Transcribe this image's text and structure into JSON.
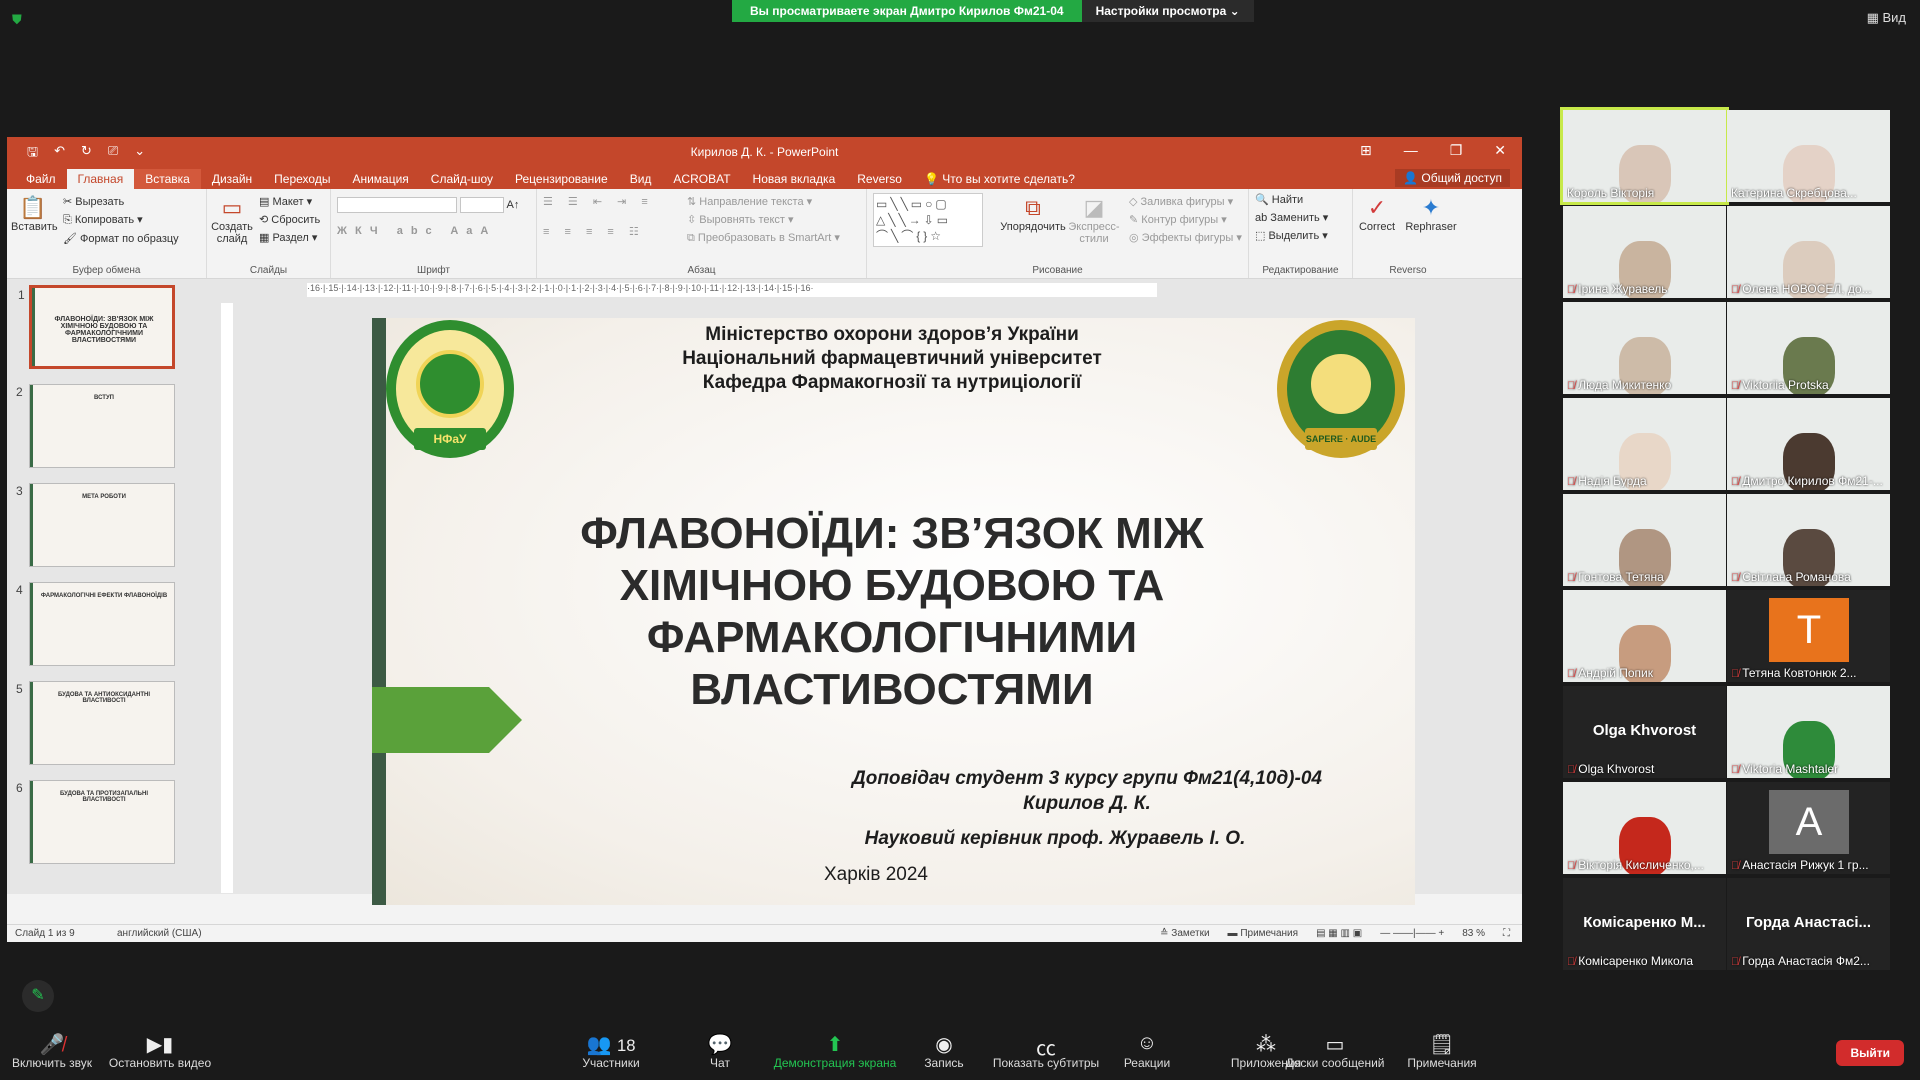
{
  "zoom": {
    "share_text": "Вы просматриваете экран Дмитро Кирилов Фм21-04",
    "view_settings": "Настройки просмотра",
    "view_label": "Вид",
    "toolbar": [
      {
        "label": "Включить звук",
        "icon": "mic-muted-icon"
      },
      {
        "label": "Остановить видео",
        "icon": "video-icon"
      },
      {
        "label": "Участники",
        "icon": "participants-icon",
        "count": "18"
      },
      {
        "label": "Чат",
        "icon": "chat-icon"
      },
      {
        "label": "Демонстрация экрана",
        "icon": "share-screen-icon"
      },
      {
        "label": "Запись",
        "icon": "record-icon"
      },
      {
        "label": "Показать субтитры",
        "icon": "cc-icon"
      },
      {
        "label": "Реакции",
        "icon": "reactions-icon"
      },
      {
        "label": "Приложения",
        "icon": "apps-icon"
      },
      {
        "label": "Доски сообщений",
        "icon": "whiteboard-icon"
      },
      {
        "label": "Примечания",
        "icon": "notes-icon"
      }
    ],
    "leave": "Выйти",
    "participants": [
      {
        "name": "Король Вікторія",
        "muted": false,
        "active": true
      },
      {
        "name": "Катерина Скребцова...",
        "muted": false
      },
      {
        "name": "Ірина Журавель",
        "muted": true
      },
      {
        "name": "Олена НОВОСЕЛ, до...",
        "muted": true
      },
      {
        "name": "Люда Микитенко",
        "muted": true
      },
      {
        "name": "Viktoriia Protska",
        "muted": true
      },
      {
        "name": "Надія Бурда",
        "muted": true
      },
      {
        "name": "Дмитро Кирилов Фм21-...",
        "muted": true
      },
      {
        "name": "Гонтова Тетяна",
        "muted": true
      },
      {
        "name": "Світлана Романова",
        "muted": true
      },
      {
        "name": "Андрій Попик",
        "muted": true
      },
      {
        "name": "Тетяна Ковтонюк 2...",
        "muted": true,
        "letter": "T"
      },
      {
        "name": "Olga Khvorost",
        "muted": true,
        "bigname": "Olga Khvorost"
      },
      {
        "name": "Viktoria Mashtaler",
        "muted": true
      },
      {
        "name": "Вікторія Кисличенко,...",
        "muted": true
      },
      {
        "name": "Анастасія Рижук 1 гр...",
        "muted": true,
        "letter": "A"
      },
      {
        "name": "Комісаренко Микола",
        "muted": true,
        "bigname": "Комісаренко М..."
      },
      {
        "name": "Горда Анастасія Фм2...",
        "muted": true,
        "bigname": "Горда Анастасі..."
      }
    ]
  },
  "ppt": {
    "window_title": "Кирилов Д. К.  -  PowerPoint",
    "tabs": [
      "Файл",
      "Главная",
      "Вставка",
      "Дизайн",
      "Переходы",
      "Анимация",
      "Слайд-шоу",
      "Рецензирование",
      "Вид",
      "ACROBAT",
      "Новая вкладка",
      "Reverso"
    ],
    "tell_me": "Что вы хотите сделать?",
    "share": "Общий доступ",
    "ribbon": {
      "paste": "Вставить",
      "cut": "Вырезать",
      "copy": "Копировать",
      "format_painter": "Формат по образцу",
      "clipboard": "Буфер обмена",
      "new_slide": "Создать слайд",
      "layout": "Макет",
      "reset": "Сбросить",
      "section": "Раздел",
      "slides": "Слайды",
      "font": "Шрифт",
      "text_direction": "Направление текста",
      "align_text": "Выровнять текст",
      "smartart": "Преобразовать в SmartArt",
      "paragraph": "Абзац",
      "arrange": "Упорядочить",
      "quick_styles": "Экспресс-стили",
      "shape_fill": "Заливка фигуры",
      "shape_outline": "Контур фигуры",
      "shape_effects": "Эффекты фигуры",
      "drawing": "Рисование",
      "find": "Найти",
      "replace": "Заменить",
      "select": "Выделить",
      "editing": "Редактирование",
      "correct": "Correct",
      "rephraser": "Rephraser",
      "reverso": "Reverso"
    },
    "thumbnails": [
      {
        "num": "1",
        "title": "ФЛАВОНОЇДИ: ЗВ'ЯЗОК МІЖ ХІМІЧНОЮ БУДОВОЮ ТА ФАРМАКОЛОГІЧНИМИ ВЛАСТИВОСТЯМИ"
      },
      {
        "num": "2",
        "title": "ВСТУП"
      },
      {
        "num": "3",
        "title": "МЕТА РОБОТИ"
      },
      {
        "num": "4",
        "title": "ФАРМАКОЛОГІЧНІ ЕФЕКТИ ФЛАВОНОЇДІВ"
      },
      {
        "num": "5",
        "title": "БУДОВА ТА АНТИОКСИДАНТНІ ВЛАСТИВОСТІ"
      },
      {
        "num": "6",
        "title": "БУДОВА ТА ПРОТИЗАПАЛЬНІ ВЛАСТИВОСТІ"
      }
    ],
    "ruler": "·16·|·15·|·14·|·13·|·12·|·11·|·10·|·9·|·8·|·7·|·6·|·5·|·4·|·3·|·2·|·1·|·0·|·1·|·2·|·3·|·4·|·5·|·6·|·7·|·8·|·9·|·10·|·11·|·12·|·13·|·14·|·15·|·16·",
    "slide": {
      "header1": "Міністерство охорони здоров’я України",
      "header2": "Національний фармацевтичний університет",
      "header3": "Кафедра Фармакогнозії та нутриціології",
      "title": "ФЛАВОНОЇДИ: ЗВ’ЯЗОК МІЖ ХІМІЧНОЮ БУДОВОЮ ТА ФАРМАКОЛОГІЧНИМИ ВЛАСТИВОСТЯМИ",
      "reporter": "Доповідач студент 3 курсу групи Фм21(4,10д)-04",
      "reporter_name": "Кирилов Д. К.",
      "supervisor": "Науковий керівник проф. Журавель І. О.",
      "city": "Харків 2024",
      "logo_left": "НФаУ",
      "logo_right": "SAPERE · AUDE"
    },
    "status": {
      "slide": "Слайд 1 из 9",
      "lang": "английский (США)",
      "notes": "Заметки",
      "comments": "Примечания",
      "zoom": "83 %"
    }
  }
}
